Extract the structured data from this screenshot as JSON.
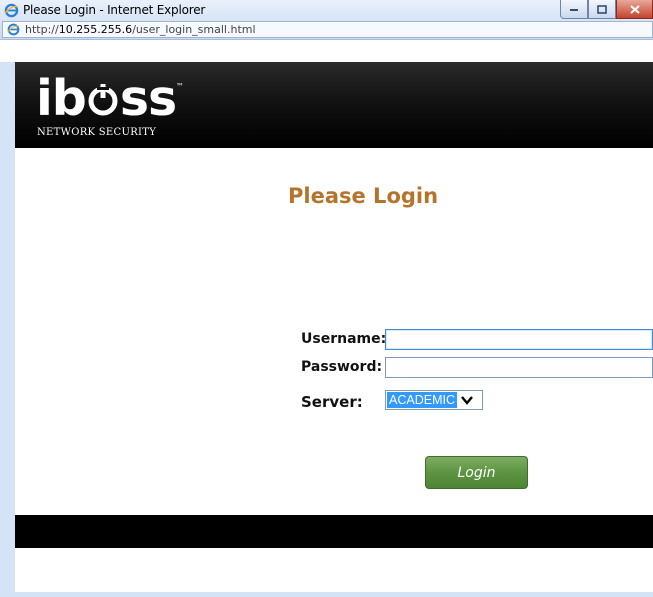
{
  "window": {
    "title": "Please Login - Internet Explorer",
    "address_prefix": "http://",
    "address_host": "10.255.255.6",
    "address_path": "/user_login_small.html"
  },
  "header": {
    "logo": "ibss",
    "logo_tm": "™",
    "tagline": "NETWORK SECURITY"
  },
  "main": {
    "title": "Please Login",
    "username_label": "Username:",
    "username_value": "",
    "password_label": "Password:",
    "password_value": "",
    "server_label": "Server:",
    "server_selected": "ACADEMIC",
    "login_button": "Login"
  },
  "colors": {
    "title": "#b5742b",
    "button": "#5d9441",
    "header": "#000000",
    "select_highlight": "#3399ff"
  },
  "icons": {
    "browser": "ie-icon",
    "power": "power-icon",
    "dropdown": "chevron-down-icon"
  }
}
